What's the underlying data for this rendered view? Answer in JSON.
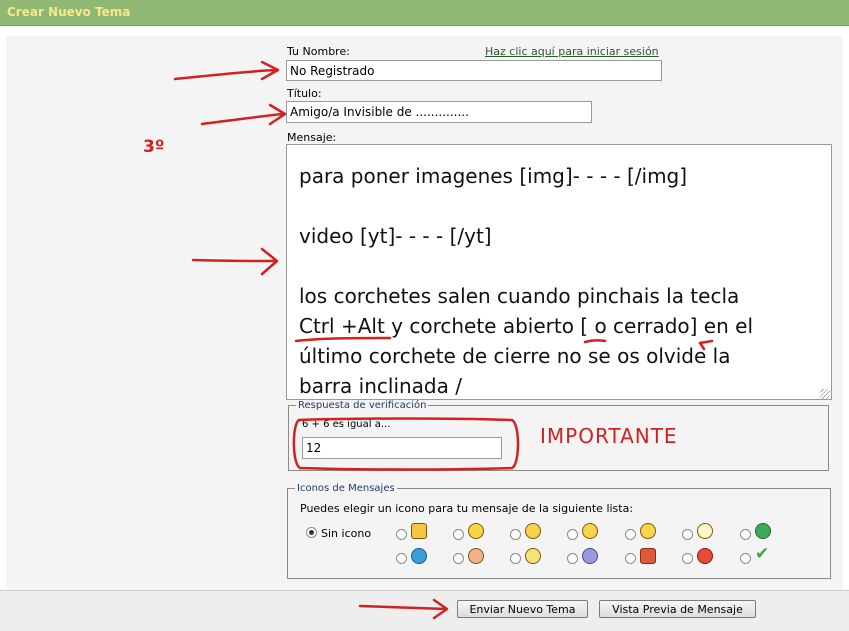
{
  "header": {
    "title": "Crear Nuevo Tema"
  },
  "form": {
    "name_label": "Tu Nombre:",
    "login_link": "Haz clic aquí para iniciar sesión",
    "name_value": "No Registrado",
    "title_label": "Título:",
    "title_value": "Amigo/a Invisible de ..............",
    "message_label": "Mensaje:",
    "message_lines": [
      "para poner imagenes [img]- - - - [/img]",
      "",
      "video [yt]- - - - [/yt]",
      "",
      "los corchetes salen cuando pinchais la tecla",
      "Ctrl +Alt y corchete abierto [ o cerrado] en el",
      "último corchete de cierre no se os olvide la",
      "barra inclinada /"
    ]
  },
  "verification": {
    "legend": "Respuesta de verificación",
    "question": "6 + 6 es igual a...",
    "answer": "12"
  },
  "icons": {
    "legend": "Iconos de Mensajes",
    "prompt": "Puedes elegir un icono para tu mensaje de la siguiente lista:",
    "none_label": "Sin icono",
    "selected": "Sin icono",
    "row1": [
      "thumbs-up-icon",
      "grin-icon",
      "laugh-icon",
      "wink-icon",
      "cool-icon",
      "idea-icon",
      "big-smile-icon"
    ],
    "row2": [
      "question-icon",
      "blush-icon",
      "confused-icon",
      "sad-icon",
      "thumbs-down-icon",
      "angry-icon",
      "check-icon"
    ]
  },
  "buttons": {
    "submit": "Enviar Nuevo Tema",
    "preview": "Vista Previa de Mensaje"
  },
  "annotations": {
    "step": "3º",
    "important": "IMPORTANTE",
    "ink_color": "#d42020"
  }
}
